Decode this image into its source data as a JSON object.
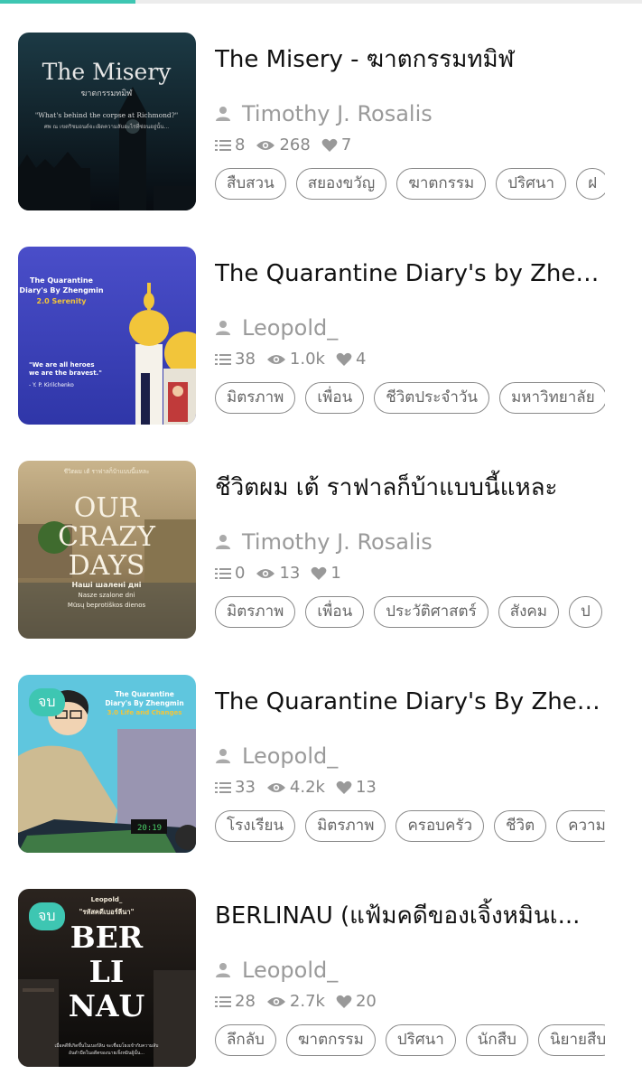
{
  "books": [
    {
      "title": "The Misery - ฆาตกรรมทมิฬ",
      "author": "Timothy J. Rosalis",
      "chapters": "8",
      "views": "268",
      "likes": "7",
      "tags": [
        "สืบสวน",
        "สยองขวัญ",
        "ฆาตกรรม",
        "ปริศนา",
        "ฝ"
      ],
      "cover": {
        "line1": "The Misery",
        "line2": "ฆาตกรรมทมิฬ",
        "line3": "\"What's behind the corpse at Richmond?\"",
        "line4": "ศพ ณ เขตริชมอนด์จะเผิดความลับอะไรที่ซ่อนอยู่นั้น..."
      }
    },
    {
      "title": "The Quarantine Diary's by Zhen...",
      "author": "Leopold_",
      "chapters": "38",
      "views": "1.0k",
      "likes": "4",
      "tags": [
        "มิตรภาพ",
        "เพื่อน",
        "ชีวิตประจำวัน",
        "มหาวิทยาลัย"
      ],
      "cover": {
        "line1": "The Quarantine",
        "line2": "Diary's By Zhengmin",
        "line3": "2.0 Serenity",
        "line4": "\"We are all heroes",
        "line5": "we are the bravest.\"",
        "line6": "- Y. P. Kirilchenko"
      }
    },
    {
      "title": "ชีวิตผม เต้ ราฟาลก็บ้าแบบนี้แหละ",
      "author": "Timothy J. Rosalis",
      "chapters": "0",
      "views": "13",
      "likes": "1",
      "tags": [
        "มิตรภาพ",
        "เพื่อน",
        "ประวัติศาสตร์",
        "สังคม",
        "ป"
      ],
      "cover": {
        "line0": "ชีวิตผม เต้ ราฟาลก็บ้าแบบนี้แหละ",
        "line1": "OUR",
        "line2": "CRAZY",
        "line3": "DAYS",
        "line4": "Наші шалені дні",
        "line5": "Nasze szalone dni",
        "line6": "Mūsų beprotiškos dienos"
      }
    },
    {
      "title": "The Quarantine Diary's By Zhen...",
      "author": "Leopold_",
      "chapters": "33",
      "views": "4.2k",
      "likes": "13",
      "badge": "จบ",
      "tags": [
        "โรงเรียน",
        "มิตรภาพ",
        "ครอบครัว",
        "ชีวิต",
        "ความ"
      ],
      "cover": {
        "line1": "The Quarantine",
        "line2": "Diary's By Zhengmin",
        "line3": "3.0 Life and Changes",
        "line4": "20:19"
      }
    },
    {
      "title": "BERLINAU (แฟ้มคดีของเจิ้งหมินเ...",
      "author": "Leopold_",
      "chapters": "28",
      "views": "2.7k",
      "likes": "20",
      "badge": "จบ",
      "tags": [
        "ลึกลับ",
        "ฆาตกรรม",
        "ปริศนา",
        "นักสืบ",
        "นิยายสืบ"
      ],
      "cover": {
        "line0": "Leopold_",
        "line1": "\"รหัสคดีเบอร์ลีนา\"",
        "line2": "BER",
        "line3": "LI",
        "line4": "NAU",
        "line5": "เมื่อคดีที่เกิดขึ้นในเบอร์ลิน จะเชื่อมโยงเข้ากับความลับ",
        "line6": "อันดำมืดในอดีตของนายเจิ้งหมินผู้นั้น..."
      }
    }
  ],
  "colors": {
    "accent": "#3ec6b2",
    "muted": "#9a9a9a",
    "tag_border": "#8a8a8a"
  },
  "icons": {
    "author": "person-icon",
    "chapters": "list-icon",
    "views": "eye-icon",
    "likes": "heart-icon"
  }
}
